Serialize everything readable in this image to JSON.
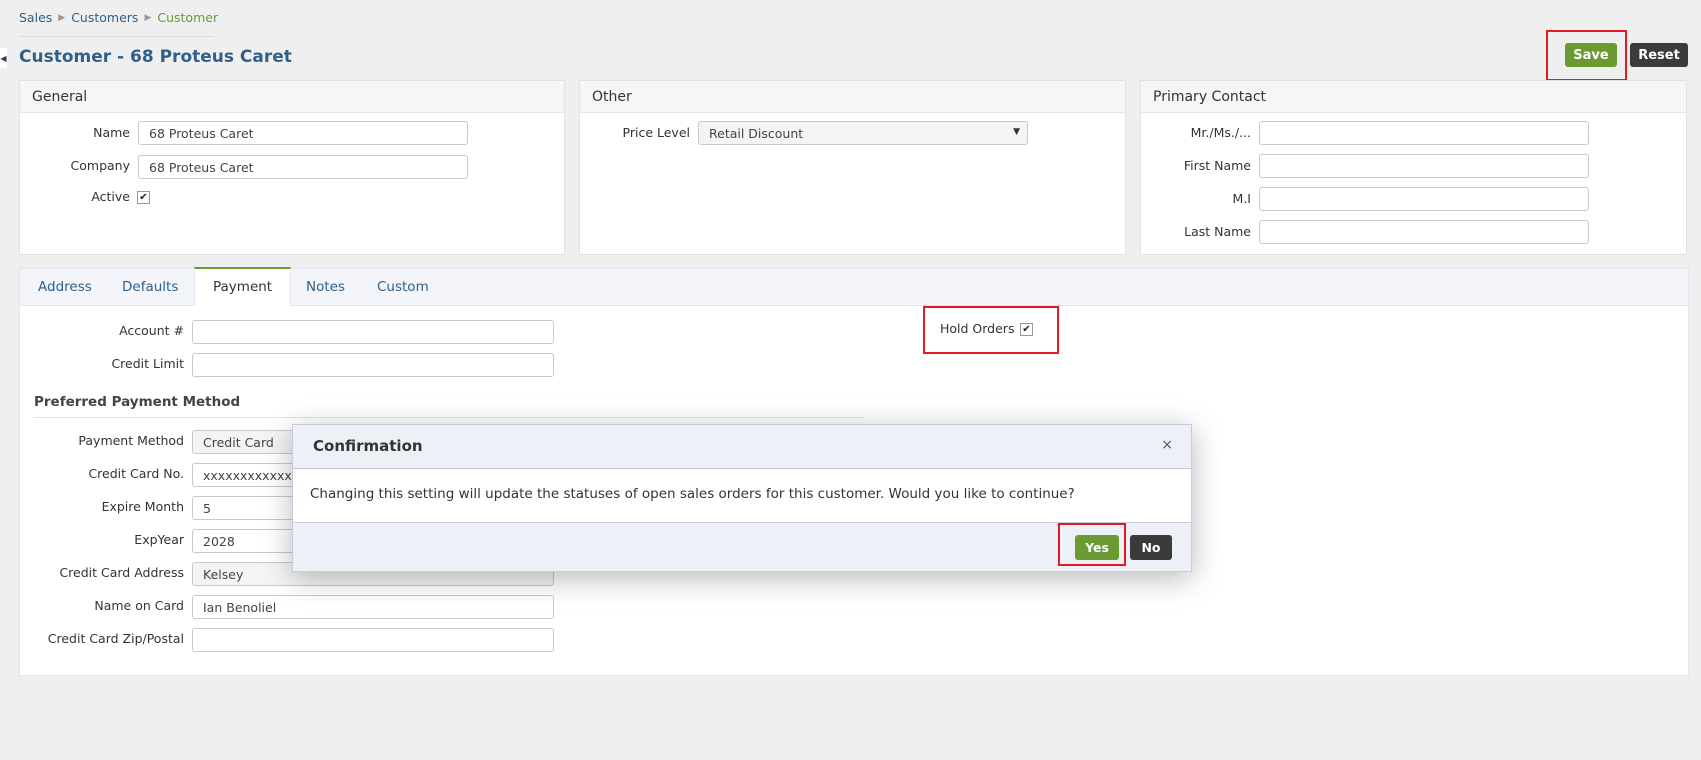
{
  "breadcrumb": {
    "items": [
      "Sales",
      "Customers",
      "Customer"
    ]
  },
  "page": {
    "title": "Customer - 68 Proteus Caret"
  },
  "toolbar": {
    "save_label": "Save",
    "reset_label": "Reset"
  },
  "general": {
    "title": "General",
    "name_label": "Name",
    "name_value": "68 Proteus Caret",
    "company_label": "Company",
    "company_value": "68 Proteus Caret",
    "active_label": "Active"
  },
  "other": {
    "title": "Other",
    "price_level_label": "Price Level",
    "price_level_value": "Retail Discount"
  },
  "primary_contact": {
    "title": "Primary Contact",
    "mr_label": "Mr./Ms./...",
    "first_name_label": "First Name",
    "mi_label": "M.I",
    "last_name_label": "Last Name"
  },
  "tabs": [
    {
      "label": "Address"
    },
    {
      "label": "Defaults"
    },
    {
      "label": "Payment"
    },
    {
      "label": "Notes"
    },
    {
      "label": "Custom"
    }
  ],
  "payment": {
    "account_label": "Account #",
    "credit_limit_label": "Credit Limit",
    "hold_orders_label": "Hold Orders",
    "preferred_title": "Preferred Payment Method",
    "payment_method_label": "Payment Method",
    "payment_method_value": "Credit Card",
    "card_no_label": "Credit Card No.",
    "card_no_value": "xxxxxxxxxxxx11",
    "expire_month_label": "Expire Month",
    "expire_month_value": "5",
    "exp_year_label": "ExpYear",
    "exp_year_value": "2028",
    "card_address_label": "Credit Card Address",
    "card_address_value": "Kelsey",
    "name_on_card_label": "Name on Card",
    "name_on_card_value": "Ian Benoliel",
    "zip_label": "Credit Card Zip/Postal"
  },
  "modal": {
    "title": "Confirmation",
    "close": "×",
    "message": "Changing this setting will update the statuses of open sales orders for this customer. Would you like to continue?",
    "yes_label": "Yes",
    "no_label": "No"
  },
  "icons": {
    "check": "✔",
    "dropdown": "▼",
    "breadcrumb_sep": "▶",
    "collapse": "◀"
  },
  "colors": {
    "accent_green": "#6a9a31",
    "link_blue": "#2f5f8a",
    "highlight_red": "#e01b24",
    "dark_button": "#3b3b3b"
  }
}
